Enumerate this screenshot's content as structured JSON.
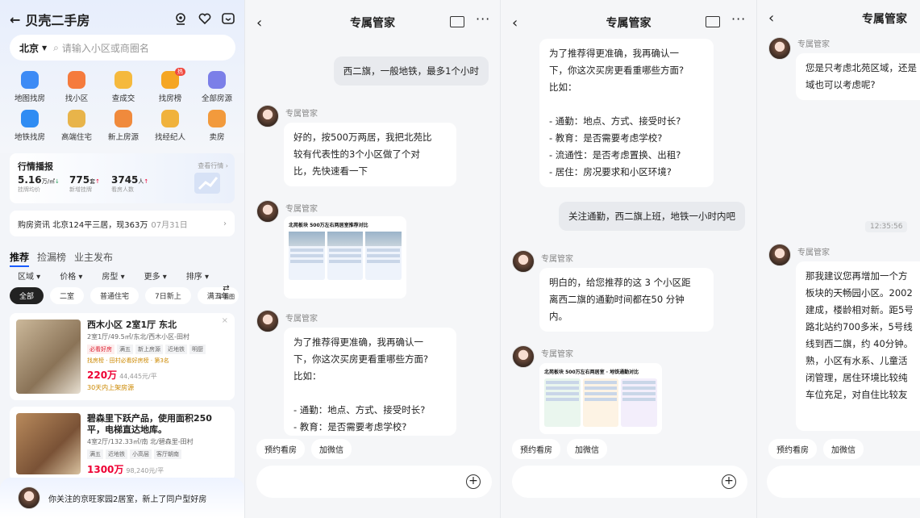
{
  "app": {
    "title": "贝壳二手房",
    "city": "北京",
    "search_placeholder": "请输入小区或商圈名"
  },
  "grid": [
    {
      "label": "地图找房",
      "color": "#3d8bf5"
    },
    {
      "label": "找小区",
      "color": "#f57b3d"
    },
    {
      "label": "查成交",
      "color": "#f5b93d"
    },
    {
      "label": "找房榜",
      "color": "#f5a623",
      "badge": "热"
    },
    {
      "label": "全部房源",
      "color": "#7b7fe8"
    },
    {
      "label": "地铁找房",
      "color": "#2f8cf3"
    },
    {
      "label": "高端住宅",
      "color": "#e8b44a"
    },
    {
      "label": "新上房源",
      "color": "#f08a3c"
    },
    {
      "label": "找经纪人",
      "color": "#f0b23c"
    },
    {
      "label": "卖房",
      "color": "#f29a3c"
    }
  ],
  "market": {
    "title": "行情播报",
    "more": "查看行情 ›",
    "stats": [
      {
        "value": "5.16",
        "unit": "万/㎡",
        "arrow": "↓",
        "label": "挂牌均价"
      },
      {
        "value": "775",
        "unit": "套",
        "arrow": "↑",
        "label": "新增挂牌"
      },
      {
        "value": "3745",
        "unit": "人",
        "arrow": "↑",
        "label": "看房人数"
      }
    ]
  },
  "news": {
    "text": "购房资讯 北京124平三居，现363万",
    "date": "07月31日"
  },
  "tabs": [
    "推荐",
    "捡漏榜",
    "业主发布"
  ],
  "filters": [
    "区域 ▾",
    "价格 ▾",
    "房型 ▾",
    "更多 ▾",
    "排序 ▾"
  ],
  "chips": [
    "全部",
    "二室",
    "普通住宅",
    "7日新上",
    "满五年"
  ],
  "layout_toggle": "平面图",
  "listings": [
    {
      "title": "西木小区 2室1厅 东北",
      "sub": "2室1厅/49.5㎡/东北/西木小区-田村",
      "tags": [
        "必看好房",
        "满五",
        "新上房源",
        "近地铁",
        "明厨"
      ],
      "rank": "找房榜 · 田村必看好房榜 · 第3名",
      "price": "220万",
      "unit_price": "44,445元/平",
      "note": "30天内上架房源"
    },
    {
      "title": "碧森里下跃产品，使用面积250平，电梯直达地库。",
      "sub": "4室2厅/132.33㎡/南 北/碧森里-田村",
      "tags": [
        "满五",
        "近地铁",
        "小高层",
        "客厅朝南"
      ],
      "price": "1300万",
      "unit_price": "98,240元/平"
    }
  ],
  "notification": "你关注的京旺家园2居室，新上了同户型好房",
  "chat": {
    "title": "专属管家",
    "agent_name": "专属管家",
    "quick_replies": [
      "预约看房",
      "加微信"
    ],
    "p2": {
      "user1": "西二旗，一般地铁，最多1个小时",
      "bot1": "好的，按500万两居，我把北苑比\n较有代表性的3个小区做了个对\n比，先快速看一下",
      "card_title": "北苑板块 500万左右两居室推荐对比",
      "bot2": "为了推荐得更准确，我再确认一\n下，你这次买房更看重哪些方面?\n比如：\n\n- 通勤：地点、方式、接受时长?\n- 教育：是否需要考虑学校?"
    },
    "p3": {
      "bot1": "为了推荐得更准确，我再确认一\n下，你这次买房更看重哪些方面?\n比如：\n\n- 通勤：地点、方式、接受时长?\n- 教育：是否需要考虑学校?\n- 流通性：是否考虑置换、出租?\n- 居住：房况要求和小区环境?",
      "user1": "关注通勤，西二旗上班，地铁一小时内吧",
      "bot2": "明白的，给您推荐的这 3 个小区距\n离西二旗的通勤时间都在50 分钟\n内。",
      "card_title": "北苑板块 500万左右两居室 · 地铁通勤对比"
    },
    "p4": {
      "bot1": "您是只考虑北苑区域，还是\n域也可以考虑呢?",
      "time": "12:35:56",
      "bot2": "那我建议您再增加一个方\n板块的天畅园小区。2002\n建成，楼龄相对新。距5号\n路北站约700多米，5号线\n线到西二旗，约 40分钟。\n熟，小区有水系、儿童活\n闭管理，居住环境比较纯\n车位充足，对自住比较友"
    }
  }
}
